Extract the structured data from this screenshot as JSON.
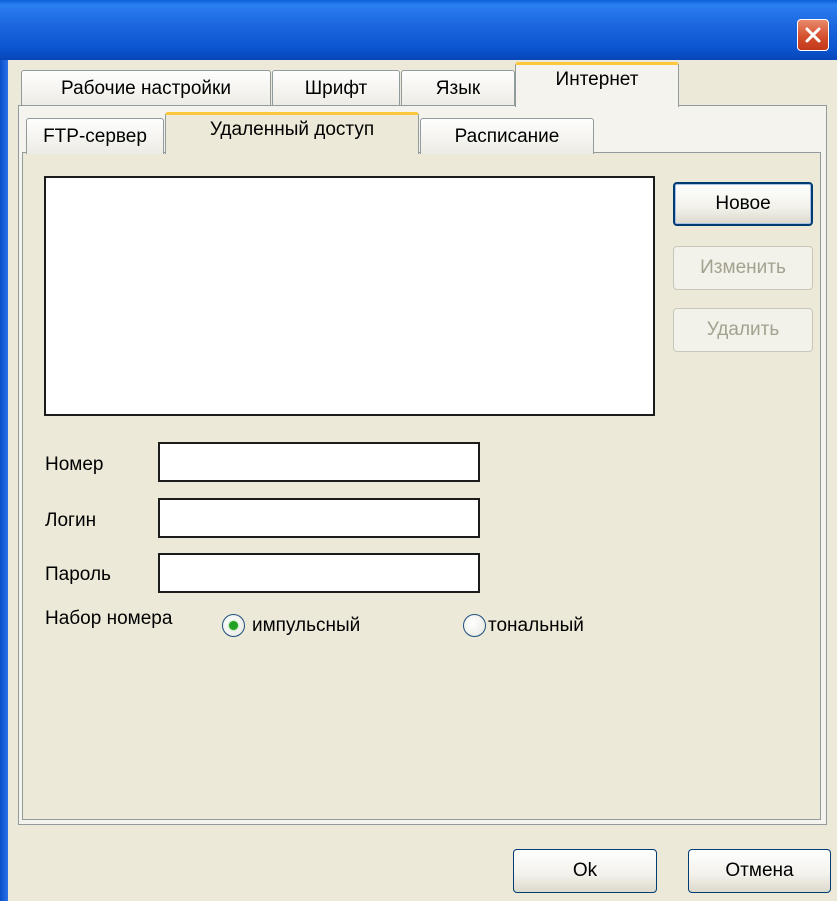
{
  "window": {
    "title": "",
    "close_icon": "close-icon",
    "accent_color": "#0a5fd8",
    "close_color": "#d4502f"
  },
  "tabs": [
    {
      "label": "Рабочие настройки",
      "active": false
    },
    {
      "label": "Шрифт",
      "active": false
    },
    {
      "label": "Язык",
      "active": false
    },
    {
      "label": "Интернет",
      "active": true
    }
  ],
  "subtabs": [
    {
      "label": "FTP-сервер",
      "active": false
    },
    {
      "label": "Удаленный доступ",
      "active": true
    },
    {
      "label": "Расписание",
      "active": false
    }
  ],
  "list_actions": {
    "new_label": "Новое",
    "edit_label": "Изменить",
    "delete_label": "Удалить",
    "edit_enabled": false,
    "delete_enabled": false
  },
  "form": {
    "number_label": "Номер",
    "number_value": "",
    "login_label": "Логин",
    "login_value": "",
    "password_label": "Пароль",
    "password_value": ""
  },
  "dial": {
    "label": "Набор номера",
    "options": [
      {
        "label": "импульсный",
        "selected": true
      },
      {
        "label": "тональный",
        "selected": false
      }
    ]
  },
  "footer": {
    "ok_label": "Ok",
    "cancel_label": "Отмена"
  }
}
